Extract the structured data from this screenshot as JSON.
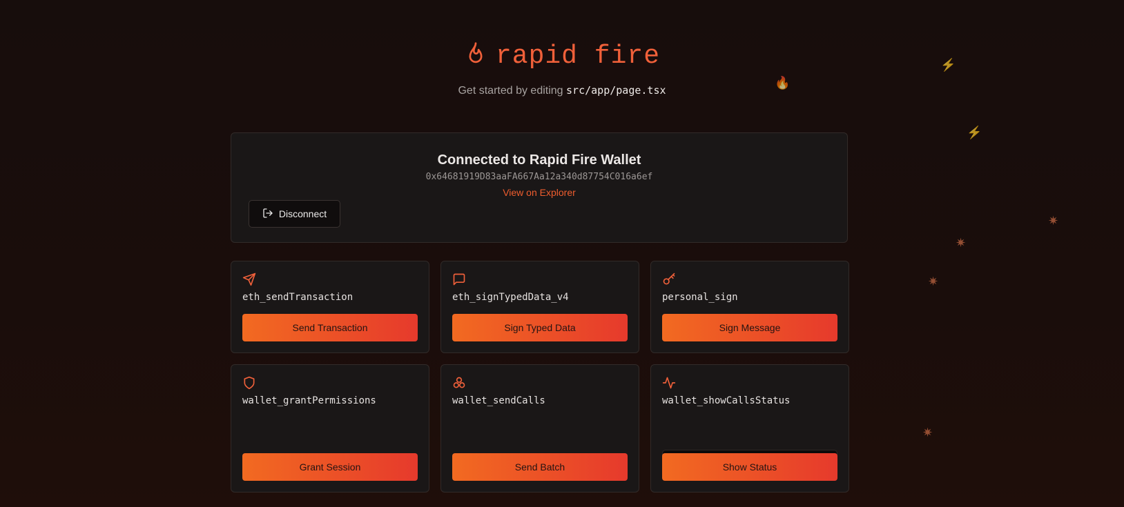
{
  "header": {
    "title": "rapid fire",
    "subtitle_prefix": "Get started by editing ",
    "subtitle_code": "src/app/page.tsx",
    "logo_icon": "flame-icon"
  },
  "connection": {
    "title": "Connected to Rapid Fire Wallet",
    "address": "0x64681919D83aaFA667Aa12a340d87754C016a6ef",
    "explorer_link": "View on Explorer",
    "disconnect_label": "Disconnect",
    "disconnect_icon": "logout-icon"
  },
  "cards": [
    {
      "method": "eth_sendTransaction",
      "button": "Send Transaction",
      "icon": "send-icon"
    },
    {
      "method": "eth_signTypedData_v4",
      "button": "Sign Typed Data",
      "icon": "message-icon"
    },
    {
      "method": "personal_sign",
      "button": "Sign Message",
      "icon": "key-icon"
    },
    {
      "method": "wallet_grantPermissions",
      "button": "Grant Session",
      "icon": "shield-icon"
    },
    {
      "method": "wallet_sendCalls",
      "button": "Send Batch",
      "icon": "boxes-icon"
    },
    {
      "method": "wallet_showCallsStatus",
      "button": "Show Status",
      "icon": "activity-icon"
    }
  ],
  "colors": {
    "accent": "#f0603a",
    "button_start": "#f26a21",
    "button_end": "#e63a2c",
    "background": "#170d0c"
  }
}
